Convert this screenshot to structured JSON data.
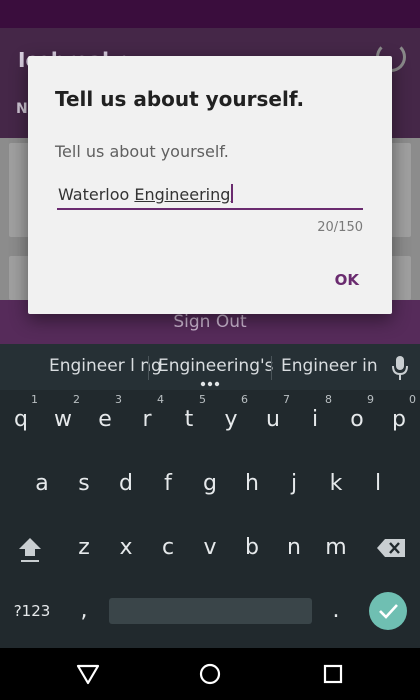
{
  "app": {
    "title": "Icebreakr",
    "subtitle": "N",
    "signout_label": "Sign Out"
  },
  "dialog": {
    "title": "Tell us about yourself.",
    "message": "Tell us about yourself.",
    "input": {
      "value_prefix": "Waterloo ",
      "value_underlined": "Engineering"
    },
    "counter": "20/150",
    "ok_label": "OK"
  },
  "keyboard": {
    "suggestions": [
      "Engineer l ng",
      "Engineering's",
      "Engineer in"
    ],
    "row1": [
      {
        "key": "q",
        "hint": "1"
      },
      {
        "key": "w",
        "hint": "2"
      },
      {
        "key": "e",
        "hint": "3"
      },
      {
        "key": "r",
        "hint": "4"
      },
      {
        "key": "t",
        "hint": "5"
      },
      {
        "key": "y",
        "hint": "6"
      },
      {
        "key": "u",
        "hint": "7"
      },
      {
        "key": "i",
        "hint": "8"
      },
      {
        "key": "o",
        "hint": "9"
      },
      {
        "key": "p",
        "hint": "0"
      }
    ],
    "row2": [
      "a",
      "s",
      "d",
      "f",
      "g",
      "h",
      "j",
      "k",
      "l"
    ],
    "row3": [
      "z",
      "x",
      "c",
      "v",
      "b",
      "n",
      "m"
    ],
    "symbols_label": "?123",
    "comma_label": ",",
    "period_label": "."
  },
  "icons": {
    "mic": "mic-icon",
    "shift": "shift-icon",
    "backspace": "backspace-icon",
    "enter": "check-icon",
    "nav_back": "back-triangle-icon",
    "nav_home": "home-circle-icon",
    "nav_recents": "recents-square-icon"
  },
  "colors": {
    "status_bar": "#3a0d3d",
    "accent": "#6a2b6f",
    "keyboard_bg": "#21292d",
    "enter_key": "#6fbfb2"
  }
}
